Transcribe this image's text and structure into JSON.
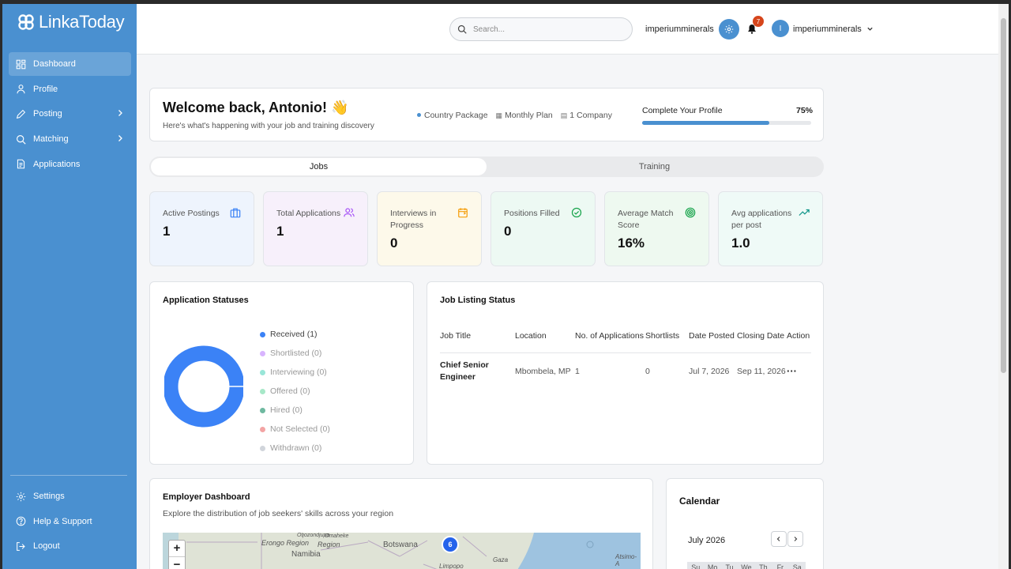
{
  "app": {
    "brand": "LinkaToday"
  },
  "sidebar": {
    "items": [
      {
        "label": "Dashboard",
        "icon": "dashboard-icon",
        "active": true
      },
      {
        "label": "Profile",
        "icon": "user-icon"
      },
      {
        "label": "Posting",
        "icon": "pencil-icon",
        "has_submenu": true
      },
      {
        "label": "Matching",
        "icon": "search-icon",
        "has_submenu": true
      },
      {
        "label": "Applications",
        "icon": "document-icon"
      }
    ],
    "bottom_items": [
      {
        "label": "Settings",
        "icon": "gear-icon"
      },
      {
        "label": "Help & Support",
        "icon": "help-icon"
      },
      {
        "label": "Logout",
        "icon": "logout-icon"
      }
    ]
  },
  "header": {
    "search_placeholder": "Search...",
    "org_name": "imperiumminerals",
    "notification_count": "7",
    "avatar_initial": "I",
    "user_name": "imperiumminerals"
  },
  "welcome": {
    "title": "Welcome back, Antonio! 👋",
    "subtitle": "Here's what's happening with your job and training discovery",
    "package": "Country Package",
    "plan": "Monthly Plan",
    "company": "1 Company",
    "profile_label": "Complete Your Profile",
    "profile_pct_label": "75%",
    "profile_progress": 0.75
  },
  "tabs": [
    {
      "label": "Jobs",
      "active": true
    },
    {
      "label": "Training",
      "active": false
    }
  ],
  "stats": [
    {
      "label": "Active Postings",
      "value": "1",
      "bg": "#eef4fd",
      "icon": "briefcase-icon",
      "icon_color": "#3b82f6"
    },
    {
      "label": "Total Applications",
      "value": "1",
      "bg": "#f7f0fb",
      "icon": "users-icon",
      "icon_color": "#a855f7"
    },
    {
      "label": "Interviews in Progress",
      "value": "0",
      "bg": "#fdf9ea",
      "icon": "calendar-icon",
      "icon_color": "#f59e0b"
    },
    {
      "label": "Positions Filled",
      "value": "0",
      "bg": "#edf9f3",
      "icon": "check-circle-icon",
      "icon_color": "#16a34a"
    },
    {
      "label": "Average Match Score",
      "value": "16%",
      "bg": "#eef9f0",
      "icon": "target-icon",
      "icon_color": "#16a34a"
    },
    {
      "label": "Avg applications per post",
      "value": "1.0",
      "bg": "#effaf7",
      "icon": "trending-up-icon",
      "icon_color": "#0d9488"
    }
  ],
  "application_statuses": {
    "title": "Application Statuses",
    "legend": [
      {
        "label": "Received (1)",
        "color": "#3b82f6",
        "value": 1
      },
      {
        "label": "Shortlisted (0)",
        "color": "#d8b4fe",
        "value": 0
      },
      {
        "label": "Interviewing (0)",
        "color": "#99e6d8",
        "value": 0
      },
      {
        "label": "Offered (0)",
        "color": "#a7e8c8",
        "value": 0
      },
      {
        "label": "Hired (0)",
        "color": "#6fb9a0",
        "value": 0
      },
      {
        "label": "Not Selected (0)",
        "color": "#f3a4a4",
        "value": 0
      },
      {
        "label": "Withdrawn (0)",
        "color": "#d1d5db",
        "value": 0
      }
    ]
  },
  "job_listing": {
    "title": "Job Listing Status",
    "columns": [
      "Job Title",
      "Location",
      "No. of Applications",
      "Shortlists",
      "Date Posted",
      "Closing Date",
      "Action"
    ],
    "rows": [
      {
        "title": "Chief Senior Engineer",
        "location": "Mbombela, MP",
        "applications": "1",
        "shortlists": "0",
        "posted": "Jul 7, 2026",
        "closing": "Sep 11, 2026",
        "action": "···"
      }
    ]
  },
  "employer_dashboard": {
    "title": "Employer Dashboard",
    "description": "Explore the distribution of job seekers' skills across your region",
    "map_labels": [
      "Erongo Region",
      "Namibia",
      "Region",
      "Botswana",
      "Limpopo",
      "Gaza",
      "Otjozondjupa",
      "Omaheke",
      "Atsimo-A"
    ],
    "cluster_count": "6",
    "zoom_in": "+",
    "zoom_out": "−"
  },
  "calendar": {
    "title": "Calendar",
    "month": "July 2026",
    "weekdays": [
      "Su",
      "Mo",
      "Tu",
      "We",
      "Th",
      "Fr",
      "Sa"
    ]
  }
}
